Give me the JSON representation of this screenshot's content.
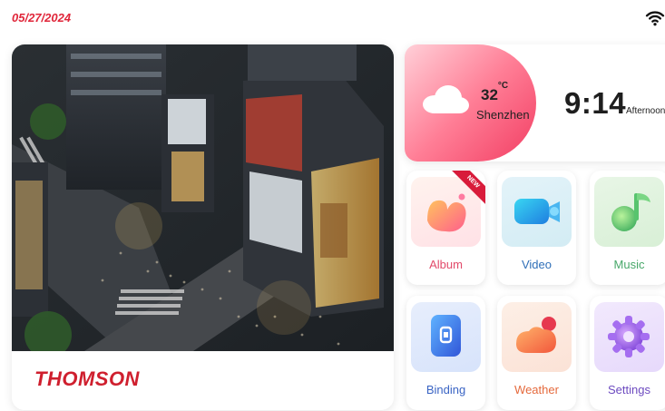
{
  "status_bar": {
    "date": "05/27/2024",
    "wifi_icon": "wifi-icon"
  },
  "photo_card": {
    "image_icon": "city-night-photo",
    "brand": "THOMSON"
  },
  "weather": {
    "icon": "cloud-icon",
    "temperature": "32",
    "unit": "°C",
    "city": "Shenzhen",
    "time": "9:14",
    "period": "Afternoon"
  },
  "apps": [
    {
      "label": "Album",
      "icon": "album-icon",
      "badge": "NEW",
      "label_color": "#e24a6a"
    },
    {
      "label": "Video",
      "icon": "video-icon",
      "badge": "",
      "label_color": "#2f6fb8"
    },
    {
      "label": "Music",
      "icon": "music-icon",
      "badge": "",
      "label_color": "#48a86a"
    },
    {
      "label": "Binding",
      "icon": "binding-icon",
      "badge": "",
      "label_color": "#3a64c4"
    },
    {
      "label": "Weather",
      "icon": "weather-icon",
      "badge": "",
      "label_color": "#e56a3d"
    },
    {
      "label": "Settings",
      "icon": "settings-icon",
      "badge": "",
      "label_color": "#6d4bc0"
    }
  ],
  "colors": {
    "accent": "#e0263a",
    "brand": "#cf1f2e"
  }
}
